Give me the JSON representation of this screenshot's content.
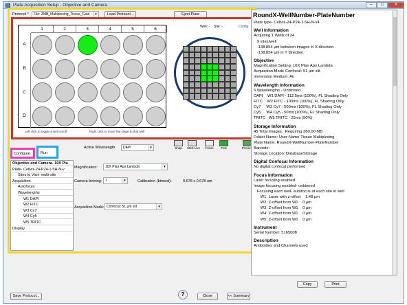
{
  "window": {
    "title": "Plate Acquisition Setup - Objective and Camera",
    "minimize": "–",
    "maximize": "□",
    "close": "✕"
  },
  "top": {
    "protocol_label": "Protocol *",
    "protocol_value": "File: ZMB_Multiplexing_Tissue_Guid",
    "load_protocol": "Load Protocol...",
    "eject_plate": "Eject Plate"
  },
  "plate": {
    "well_label": "Well: -",
    "site_label": "Site: -",
    "config_link": "Config",
    "columns": [
      "1",
      "2",
      "3",
      "4",
      "5",
      "6"
    ],
    "rows": [
      "A",
      "B",
      "C",
      "D"
    ],
    "selected_well": "A3",
    "hint_left": "Left click to toggle a well on/off",
    "hint_right": "Right click to move the stage to that well"
  },
  "site_grid": {
    "size": 9,
    "active_cells": [
      30,
      31,
      32,
      39,
      40,
      41,
      48,
      49,
      50
    ]
  },
  "tabs": {
    "configure": "Configure",
    "run": "Run"
  },
  "toolbar": {
    "active_wavelength_label": "Active Wavelength",
    "active_wavelength_value": "DAPI",
    "snap": "Snap",
    "start_live": "Start Live",
    "focus": "Focus",
    "test": "Test",
    "preview": "Preview"
  },
  "tree": {
    "items": [
      {
        "label": "Objective and Camera- 10X Pla",
        "indent": 0,
        "bold": true
      },
      {
        "label": "Plate- Cellvis-24-P24-1-5H-N-v",
        "indent": 0
      },
      {
        "label": "Sites to Visit- multi-site",
        "indent": 1
      },
      {
        "label": "Acquisition",
        "indent": 0
      },
      {
        "label": "Autofocus",
        "indent": 1
      },
      {
        "label": "Wavelengths",
        "indent": 1
      },
      {
        "label": "W1 DAPI",
        "indent": 2
      },
      {
        "label": "W2 FITC",
        "indent": 2
      },
      {
        "label": "W3 Cy7",
        "indent": 2
      },
      {
        "label": "W4 Cy5",
        "indent": 2
      },
      {
        "label": "W5 TRITC",
        "indent": 2
      },
      {
        "label": "Display",
        "indent": 0
      }
    ]
  },
  "form": {
    "magnification_label": "Magnification:",
    "magnification_value": "10X Plan Apo Lambda",
    "binning_label": "Camera binning:",
    "binning_value": "1",
    "calibration_label": "Calibration (binned):",
    "calibration_value": "0.678 x 0.678 um",
    "mode_label": "Acquisition Mode:",
    "mode_value": "Confocal: 51 µm slit"
  },
  "summary": {
    "title": "RoundX-WellNumber-PlateNumber",
    "lines": [
      {
        "t": "Plate type- Cellvis-24-P24-1-5H-N-v4",
        "h": false
      },
      {
        "t": "",
        "h": false
      },
      {
        "t": "Well Information",
        "h": true
      },
      {
        "t": "Acquiring 1 Wells of 24",
        "h": false
      },
      {
        "t": "   9 sites/well",
        "h": false
      },
      {
        "t": "   -138.854 µm between images in X direction",
        "h": false
      },
      {
        "t": "   -138.854 µm in Y direction",
        "h": false
      },
      {
        "t": "",
        "h": false
      },
      {
        "t": "Objective",
        "h": true
      },
      {
        "t": "Magnification Setting: 10X Plan Apo Lambda",
        "h": false
      },
      {
        "t": "Acquisition Mode Confocal: 51 µm slit",
        "h": false
      },
      {
        "t": "Immersion Medium: Air",
        "h": false
      },
      {
        "t": "",
        "h": false
      },
      {
        "t": "Wavelength Information",
        "h": true
      },
      {
        "t": "5 Wavelengths - Unbinned",
        "h": false
      },
      {
        "t": "DAPI    W1 DAPI - 112.5ms (100%), FL Shading Only",
        "h": false
      },
      {
        "t": "FITC    W2 FITC - 100ms (100%), FL Shading Only",
        "h": false
      },
      {
        "t": "Cy7     W3 Cy7 - 500ms (100%), FL Shading Only",
        "h": false
      },
      {
        "t": "Cy5     W4 Cy5 - 50ms (100%), FL Shading Only",
        "h": false
      },
      {
        "t": "TRITC   W5 TRITC - 25ms (50%)",
        "h": false
      },
      {
        "t": "",
        "h": false
      },
      {
        "t": "Storage Information",
        "h": true
      },
      {
        "t": "45 Total Images.  Requiring 360.00 MB",
        "h": false
      },
      {
        "t": "Folder Name: User-Name-Tissue Multiplexing",
        "h": false
      },
      {
        "t": "Plate Name: RoundX-WellNumber-PlateNumber",
        "h": false
      },
      {
        "t": "Barcode:",
        "h": false
      },
      {
        "t": "Storage Location: DatabaseStorage",
        "h": false
      },
      {
        "t": "",
        "h": false
      },
      {
        "t": "Digital Confocal Information",
        "h": true
      },
      {
        "t": "No digital confocal performed",
        "h": false
      },
      {
        "t": "",
        "h": false
      },
      {
        "t": "Focus Information",
        "h": true
      },
      {
        "t": "Laser focusing enabled",
        "h": false
      },
      {
        "t": "Image focusing enabled- unbinned",
        "h": false
      },
      {
        "t": "   Focusing each well- autofocus at each site in well",
        "h": false
      },
      {
        "t": "      W1: Laser with z-offset    1.48 µm",
        "h": false
      },
      {
        "t": "      W2: Z-offset from W1    0 µm",
        "h": false
      },
      {
        "t": "      W3: Z-offset from W1    0 µm",
        "h": false
      },
      {
        "t": "      W4: Z-offset from W1    0 µm",
        "h": false
      },
      {
        "t": "      W5: Z-offset from W1    0 µm",
        "h": false
      },
      {
        "t": "",
        "h": false
      },
      {
        "t": "Instrument",
        "h": true
      },
      {
        "t": "Serial Number: 5165008",
        "h": false
      },
      {
        "t": "",
        "h": false
      },
      {
        "t": "Description",
        "h": true
      },
      {
        "t": "Antibodies and Channels used",
        "h": false
      }
    ]
  },
  "bottom": {
    "copy": "Copy",
    "print": "Print",
    "save_protocol": "Save Protocol...",
    "help": "?",
    "close": "Close",
    "summary": "<< Summary"
  }
}
